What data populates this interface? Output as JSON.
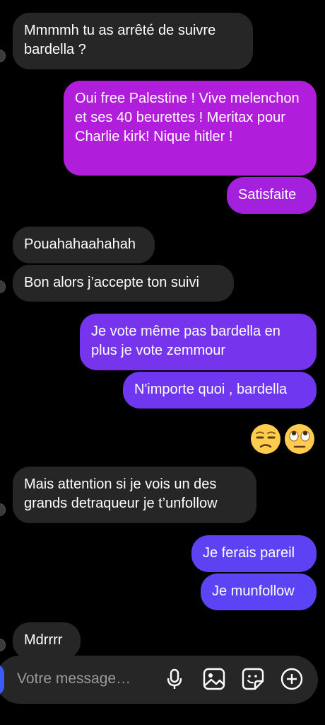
{
  "messages": [
    {
      "dir": "in",
      "text": "Mmmmh tu as arrêté de suivre bardella ?"
    },
    {
      "dir": "out",
      "text": "Oui free Palestine ! Vive melenchon et ses 40 beurettes ! Meritax pour Charlie kirk! Nique hitler !"
    },
    {
      "dir": "out",
      "text": "Satisfaite"
    },
    {
      "dir": "in",
      "text": "Pouahahaahahah"
    },
    {
      "dir": "in",
      "text": "Bon alors j’accepte ton suivi"
    },
    {
      "dir": "out",
      "text": "Je vote même pas bardella en plus je vote zemmour"
    },
    {
      "dir": "out",
      "text": "N'importe quoi , bardella"
    },
    {
      "dir": "out",
      "text": "😒🙄"
    },
    {
      "dir": "in",
      "text": "Mais attention si je vois un des grands detraqueur je t’unfollow"
    },
    {
      "dir": "out",
      "text": "Je ferais pareil"
    },
    {
      "dir": "out",
      "text": "Je munfollow"
    },
    {
      "dir": "in",
      "text": "Mdrrrr"
    }
  ],
  "composer": {
    "placeholder": "Votre message…",
    "icons": [
      "camera-icon",
      "microphone-icon",
      "gallery-icon",
      "sticker-icon",
      "plus-icon"
    ]
  },
  "colors": {
    "incoming": "#262626",
    "outgoing_gradient": [
      "#b01ddb",
      "#8a2ee8",
      "#6c3af2",
      "#5b45f4"
    ],
    "background": "#000000"
  }
}
